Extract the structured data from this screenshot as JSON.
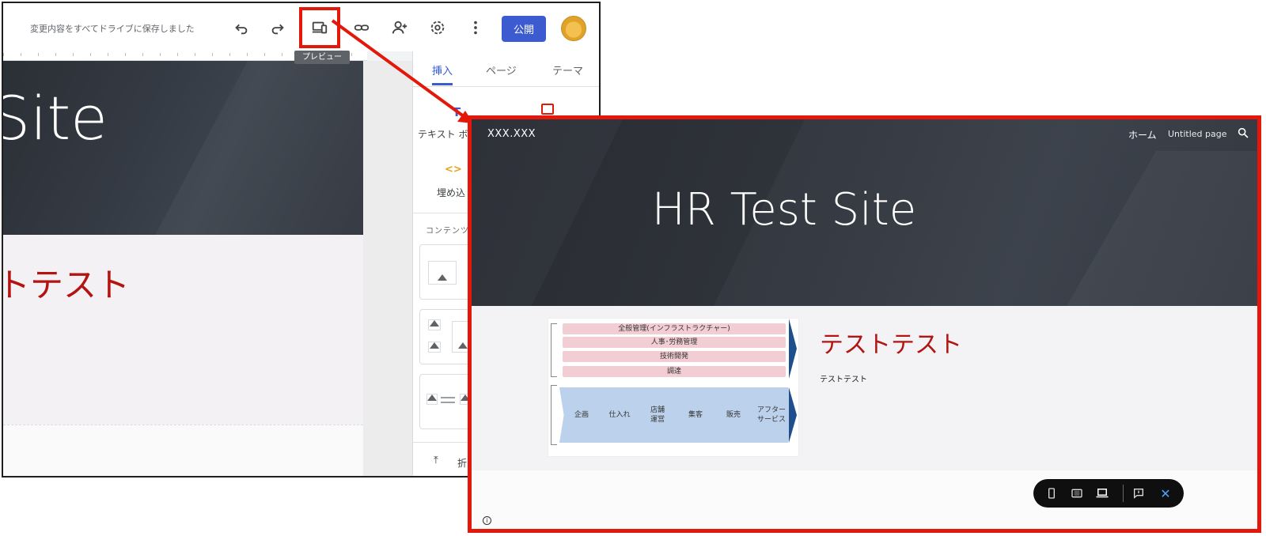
{
  "editor": {
    "save_status": "変更内容をすべてドライブに保存しました",
    "tooltip": "プレビュー",
    "publish_label": "公開",
    "hero_text": "Site",
    "heading_fragment": "トテスト",
    "panel": {
      "tabs": [
        "挿入",
        "ページ",
        "テーマ"
      ],
      "text_box_label": "テキスト ボ",
      "embed_label": "埋め込",
      "content_label": "コンテンツ",
      "collapse_label": "折"
    },
    "icons": [
      "undo-icon",
      "redo-icon",
      "preview-device-icon",
      "link-icon",
      "add-person-icon",
      "gear-icon",
      "more-vert-icon"
    ]
  },
  "preview": {
    "site_id": "XXX.XXX",
    "nav": {
      "home": "ホーム",
      "page": "Untitled page"
    },
    "title": "HR Test Site",
    "heading": "テストテスト",
    "text": "テストテスト",
    "figure": {
      "bars": [
        "全般管理(インフラストラクチャー)",
        "人事･労務管理",
        "技術開発",
        "調達"
      ],
      "chevrons": [
        "企画",
        "仕入れ",
        "店舗\n運営",
        "集客",
        "販売",
        "アフター\nサービス"
      ]
    },
    "controls": [
      "phone-icon",
      "tablet-icon",
      "laptop-icon",
      "feedback-icon",
      "close-icon"
    ]
  },
  "colors": {
    "highlight": "#e3170a",
    "publish": "#3c5bd1",
    "heading_red": "#b31412"
  }
}
